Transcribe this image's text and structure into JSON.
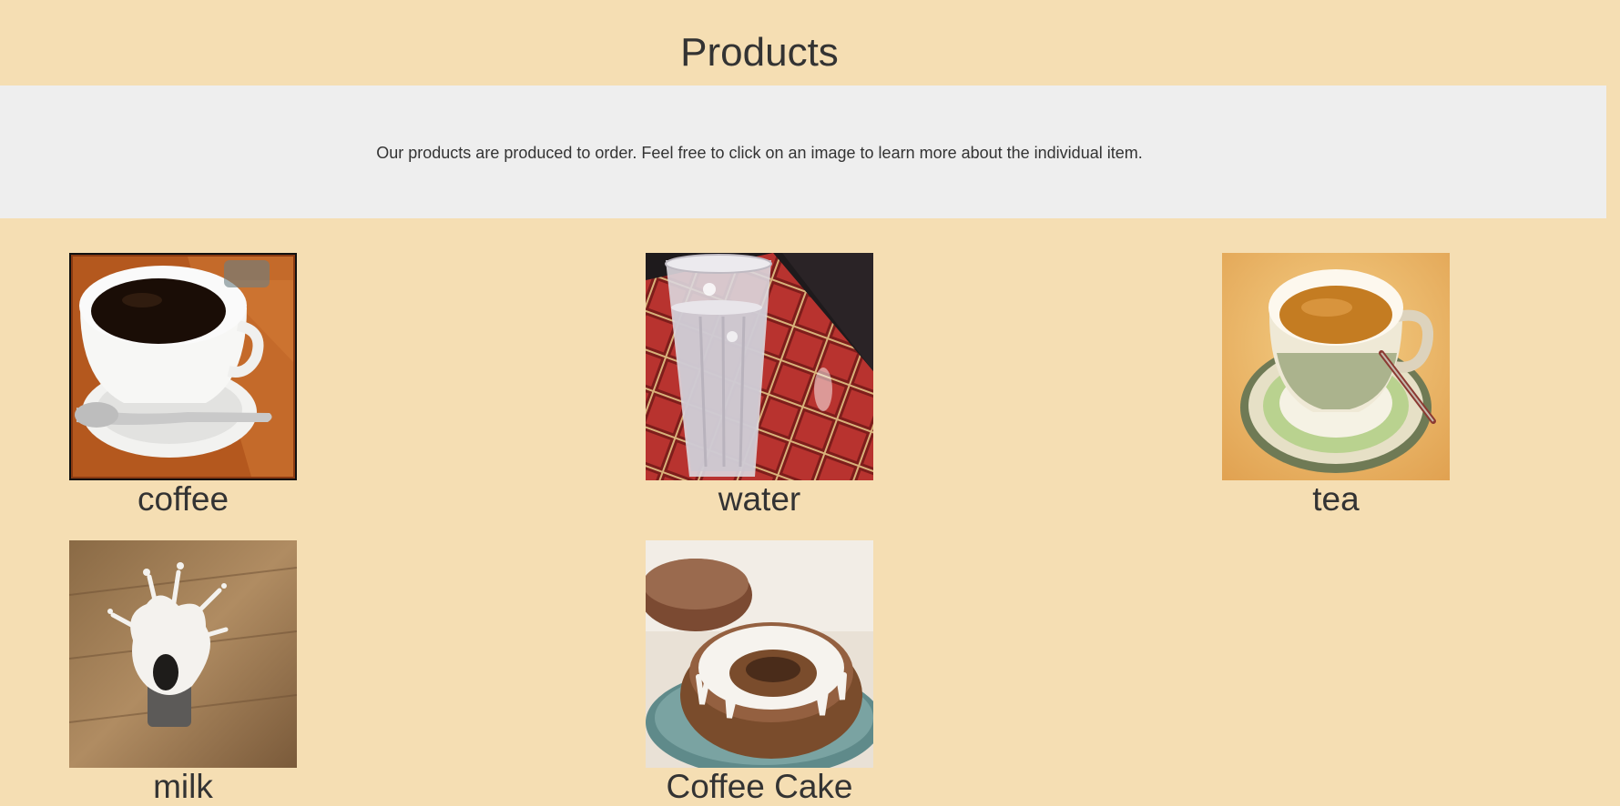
{
  "page": {
    "title": "Products",
    "intro": "Our products are produced to order. Feel free to click on an image to learn more about the individual item."
  },
  "products": [
    {
      "name": "coffee",
      "image_icon": "coffee-cup-photo"
    },
    {
      "name": "water",
      "image_icon": "water-glass-photo"
    },
    {
      "name": "tea",
      "image_icon": "tea-cup-photo"
    },
    {
      "name": "milk",
      "image_icon": "milk-splash-photo"
    },
    {
      "name": "Coffee Cake",
      "image_icon": "bundt-cake-photo"
    }
  ],
  "colors": {
    "page_background": "#f5deb3",
    "intro_background": "#eeeeee",
    "text": "#333333"
  }
}
